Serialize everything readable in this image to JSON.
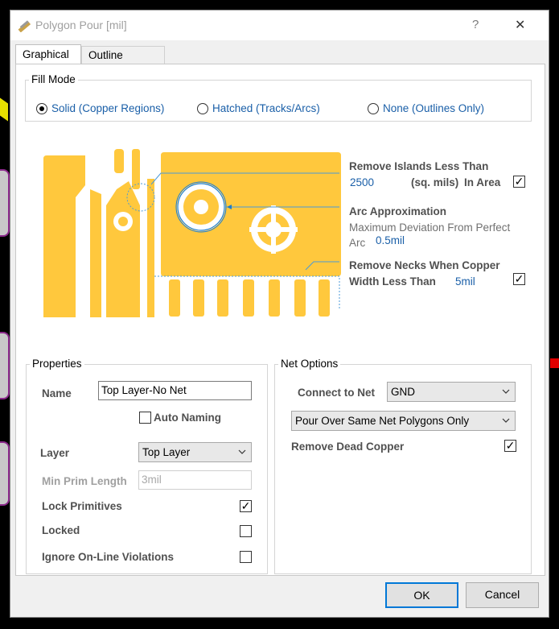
{
  "window": {
    "title": "Polygon Pour [mil]",
    "help_glyph": "?",
    "close_glyph": "✕"
  },
  "tabs": [
    {
      "label": "Graphical",
      "active": true
    },
    {
      "label": "Outline Vertices",
      "active": false
    }
  ],
  "fill_mode": {
    "legend": "Fill Mode",
    "options": [
      {
        "label": "Solid (Copper Regions)",
        "selected": true
      },
      {
        "label": "Hatched (Tracks/Arcs)",
        "selected": false
      },
      {
        "label": "None (Outlines Only)",
        "selected": false
      }
    ]
  },
  "graphic": {
    "copper_color": "#ffc83d",
    "remove_islands": {
      "label": "Remove Islands Less Than",
      "value": "2500",
      "unit": "(sq. mils)",
      "suffix": "In Area",
      "checked": true
    },
    "arc_approx": {
      "label": "Arc Approximation",
      "desc_line1": "Maximum Deviation From Perfect",
      "desc_line2": "Arc",
      "value": "0.5mil"
    },
    "remove_necks": {
      "label_line1": "Remove Necks When Copper",
      "label_line2": "Width Less Than",
      "value": "5mil",
      "checked": true
    }
  },
  "properties": {
    "legend": "Properties",
    "name_label": "Name",
    "name_value": "Top Layer-No Net",
    "auto_naming_label": "Auto Naming",
    "auto_naming_checked": false,
    "layer_label": "Layer",
    "layer_value": "Top Layer",
    "min_prim_label": "Min Prim Length",
    "min_prim_value": "3mil",
    "lock_primitives_label": "Lock Primitives",
    "lock_primitives_checked": true,
    "locked_label": "Locked",
    "locked_checked": false,
    "ignore_violations_label": "Ignore On-Line Violations",
    "ignore_violations_checked": false
  },
  "net_options": {
    "legend": "Net Options",
    "connect_label": "Connect to Net",
    "connect_value": "GND",
    "pour_mode_value": "Pour Over Same Net Polygons Only",
    "remove_dead_label": "Remove Dead Copper",
    "remove_dead_checked": true
  },
  "buttons": {
    "ok": "OK",
    "cancel": "Cancel"
  },
  "check_glyph": "✓",
  "colors": {
    "accent": "#0078d7",
    "link_blue": "#1a5fa8",
    "background_chrome": "#000000"
  }
}
